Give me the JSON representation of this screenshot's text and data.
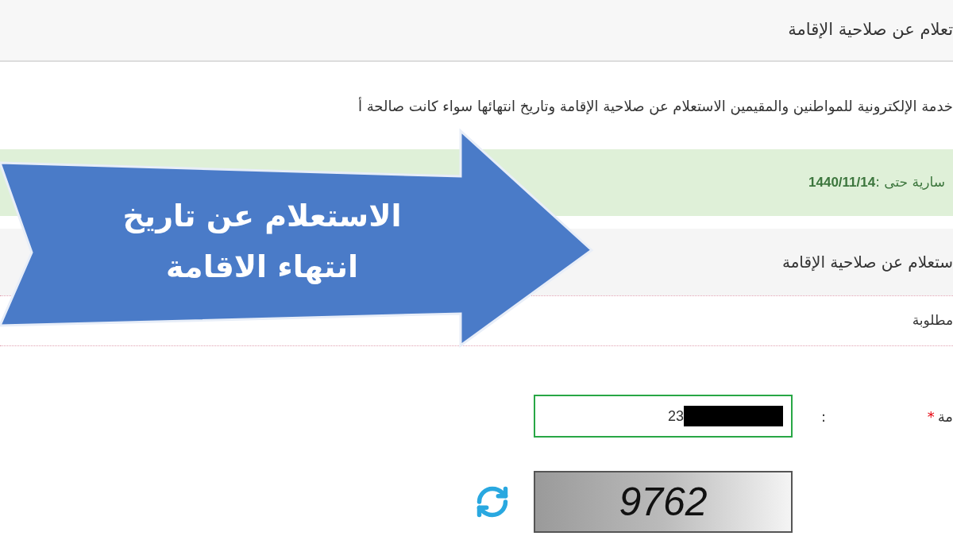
{
  "page_title": "تعلام عن صلاحية الإقامة",
  "description": "خدمة الإلكترونية للمواطنين والمقيمين الاستعلام عن صلاحية الإقامة وتاريخ انتهائها سواء كانت صالحة أ",
  "alert": {
    "label": "سارية حتى :",
    "value": "1440/11/14"
  },
  "section_title": "ستعلام عن صلاحية الإقامة",
  "required_note": "مطلوبة",
  "field": {
    "label": "مة",
    "required": true,
    "required_mark": "*",
    "colon": ":",
    "value": "23"
  },
  "captcha": {
    "text": "9762"
  },
  "callout": {
    "lines": [
      "الاستعلام عن تاريخ",
      "انتهاء الاقامة"
    ]
  }
}
